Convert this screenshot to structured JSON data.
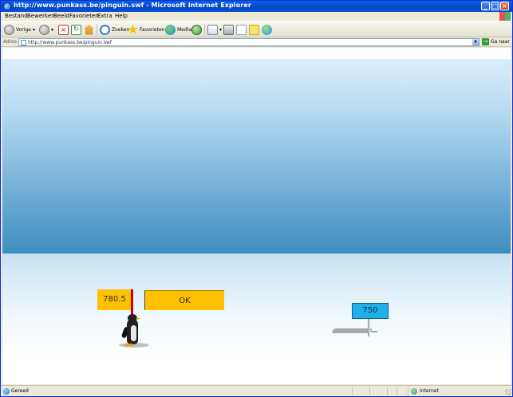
{
  "window": {
    "title": "http://www.punkass.be/pinguin.swf - Microsoft Internet Explorer"
  },
  "menu": {
    "items": [
      "Bestand",
      "Bewerken",
      "Beeld",
      "Favorieten",
      "Extra",
      "Help"
    ]
  },
  "toolbar": {
    "back_label": "Vorige",
    "search_label": "Zoeken",
    "favorites_label": "Favorieten",
    "media_label": "Media"
  },
  "address": {
    "label": "Adres",
    "url": "http://www.punkass.be/pinguin.swf",
    "go_label": "Ga naar"
  },
  "game": {
    "distance": "780.5",
    "ok_label": "OK",
    "target": "750"
  },
  "status": {
    "text": "Gereed",
    "zone": "Internet"
  },
  "colors": {
    "accent_yellow": "#FFC000",
    "sign_blue": "#1FB0E8",
    "marker_red": "#CC0000",
    "titlebar_blue": "#0A52D6"
  }
}
